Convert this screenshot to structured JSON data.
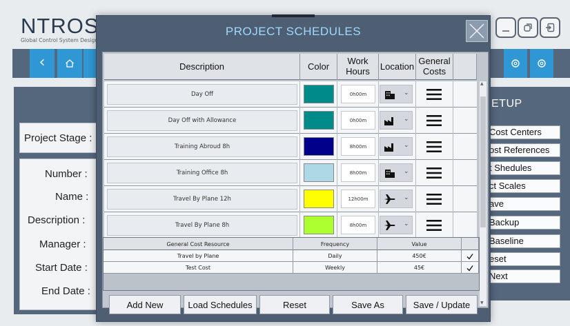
{
  "app": {
    "logo_text": "NTROSY",
    "logo_tagline": "Global Control System Designer"
  },
  "form": {
    "project_stage_label": "Project Stage :",
    "number_label": "Number :",
    "name_label": "Name :",
    "description_label": "Description :",
    "manager_label": "Manager :",
    "start_date_label": "Start Date :",
    "end_date_label": "End Date :"
  },
  "setup_panel": {
    "title": "ETUP",
    "buttons": [
      "Cost Centers",
      "ost References",
      "t Shedules",
      "ct Scales",
      "ave",
      "Backup",
      "Baseline",
      "eset",
      "Next"
    ]
  },
  "modal": {
    "title": "PROJECT SCHEDULES",
    "columns": {
      "description": "Description",
      "color": "Color",
      "work_hours": "Work Hours",
      "location": "Location",
      "general_costs": "General Costs"
    },
    "rows": [
      {
        "description": "Day Off",
        "color": "#008b8b",
        "hours": "0h00m",
        "location_icon": "building-icon"
      },
      {
        "description": "Day Off with Allowance",
        "color": "#008b8b",
        "hours": "0h00m",
        "location_icon": "factory-icon"
      },
      {
        "description": "Training Abroud 8h",
        "color": "#00008b",
        "hours": "8h00m",
        "location_icon": "factory-icon"
      },
      {
        "description": "Training Office 8h",
        "color": "#add8e6",
        "hours": "8h00m",
        "location_icon": "building-icon"
      },
      {
        "description": "Travel By Plane 12h",
        "color": "#ffff00",
        "hours": "12h00m",
        "location_icon": "plane-icon"
      },
      {
        "description": "Travel By Plane 8h",
        "color": "#adff2f",
        "hours": "8h00m",
        "location_icon": "plane-icon"
      }
    ],
    "cost_grid": {
      "columns": {
        "resource": "General Cost Resource",
        "frequency": "Frequency",
        "value": "Value"
      },
      "rows": [
        {
          "resource": "Travel by Plane",
          "frequency": "Daily",
          "value": "450€",
          "checked": true
        },
        {
          "resource": "Test Cost",
          "frequency": "Weekly",
          "value": "45€",
          "checked": true
        }
      ]
    },
    "buttons": {
      "add_new": "Add New",
      "load_schedules": "Load Schedules",
      "reset": "Reset",
      "save_as": "Save As",
      "save_update": "Save / Update"
    }
  }
}
